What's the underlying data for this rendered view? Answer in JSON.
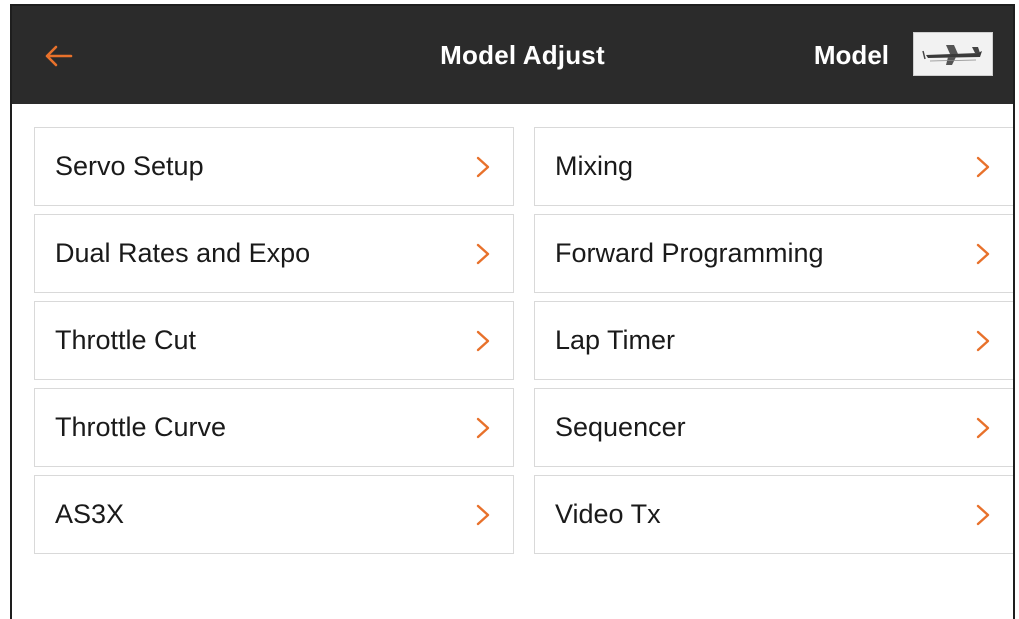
{
  "header": {
    "title": "Model Adjust",
    "model_label": "Model",
    "back_icon": "arrow-left-icon",
    "accent": "#e8712b",
    "bar_color": "#2b2b2b"
  },
  "menu": {
    "left": [
      {
        "label": "Servo Setup"
      },
      {
        "label": "Dual Rates and Expo"
      },
      {
        "label": "Throttle Cut"
      },
      {
        "label": "Throttle Curve"
      },
      {
        "label": "AS3X"
      }
    ],
    "right": [
      {
        "label": "Mixing"
      },
      {
        "label": "Forward Programming"
      },
      {
        "label": "Lap Timer"
      },
      {
        "label": "Sequencer"
      },
      {
        "label": "Video Tx"
      }
    ],
    "chevron_icon": "chevron-right-icon"
  }
}
